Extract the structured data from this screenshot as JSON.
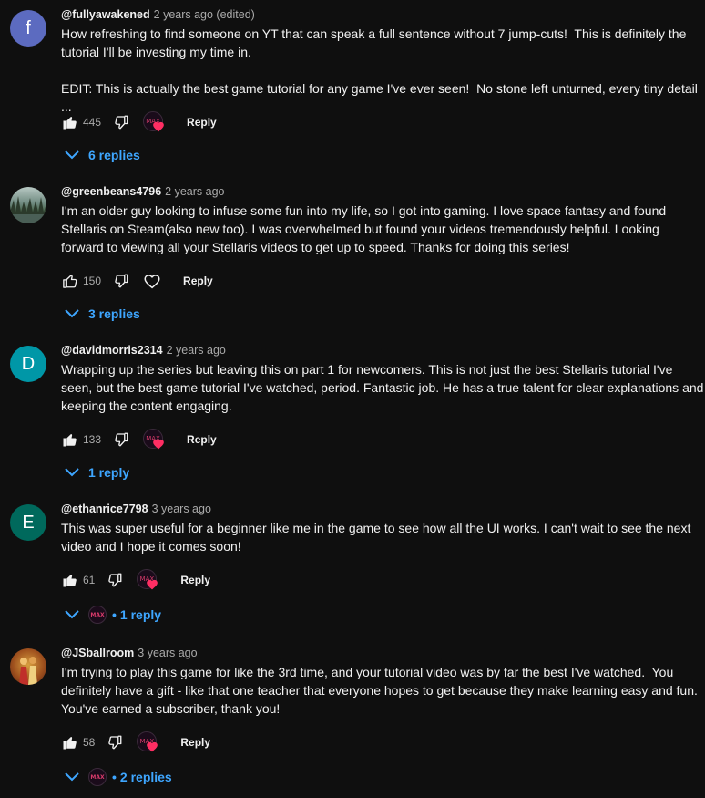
{
  "comments": [
    {
      "author": "@fullyawakened",
      "time": "2 years ago (edited)",
      "avatar_letter": "f",
      "avatar_color": "#5c6bc0",
      "text": "How refreshing to find someone on YT that can speak a full sentence without 7 jump-cuts!  This is definitely the tutorial I'll be investing my time in.\n\nEDIT: This is actually the best game tutorial for any game I've ever seen!  No stone left unturned, every tiny detail ...",
      "likes": "445",
      "reply_label": "Reply",
      "replies_label": "6 replies"
    },
    {
      "author": "@greenbeans4796",
      "time": "2 years ago",
      "text": "I'm an older guy looking to infuse some fun into my life, so I got into gaming. I love space fantasy and found Stellaris on Steam(also new too). I was overwhelmed but found your videos tremendously helpful. Looking forward to viewing all your Stellaris videos to get up to speed. Thanks for doing this series!",
      "likes": "150",
      "reply_label": "Reply",
      "replies_label": "3 replies"
    },
    {
      "author": "@davidmorris2314",
      "time": "2 years ago",
      "avatar_letter": "D",
      "avatar_color": "#0097a7",
      "text": "Wrapping up the series but leaving this on part 1 for newcomers. This is not just the best Stellaris tutorial I've seen, but the best game tutorial I've watched, period. Fantastic job. He has a true talent for clear explanations and keeping the content engaging.",
      "likes": "133",
      "reply_label": "Reply",
      "replies_label": "1 reply"
    },
    {
      "author": "@ethanrice7798",
      "time": "3 years ago",
      "avatar_letter": "E",
      "avatar_color": "#00695c",
      "text": "This was super useful for a beginner like me in the game to see how all the UI works. I can't wait to see the next video and I hope it comes soon!",
      "likes": "61",
      "reply_label": "Reply",
      "replies_label": "1 reply"
    },
    {
      "author": "@JSballroom",
      "time": "3 years ago",
      "text": "I'm trying to play this game for like the 3rd time, and your tutorial video was by far the best I've watched.  You definitely have a gift - like that one teacher that everyone hopes to get because they make learning easy and fun. You've earned a subscriber, thank you!",
      "likes": "58",
      "reply_label": "Reply",
      "replies_label": "2 replies"
    }
  ],
  "creator_badge_text": "MAX",
  "reply_dot": "•",
  "colors": {
    "background": "#0f0f0f",
    "link": "#3ea6ff",
    "heart": "#ff2e63",
    "muted": "#aaaaaa"
  }
}
